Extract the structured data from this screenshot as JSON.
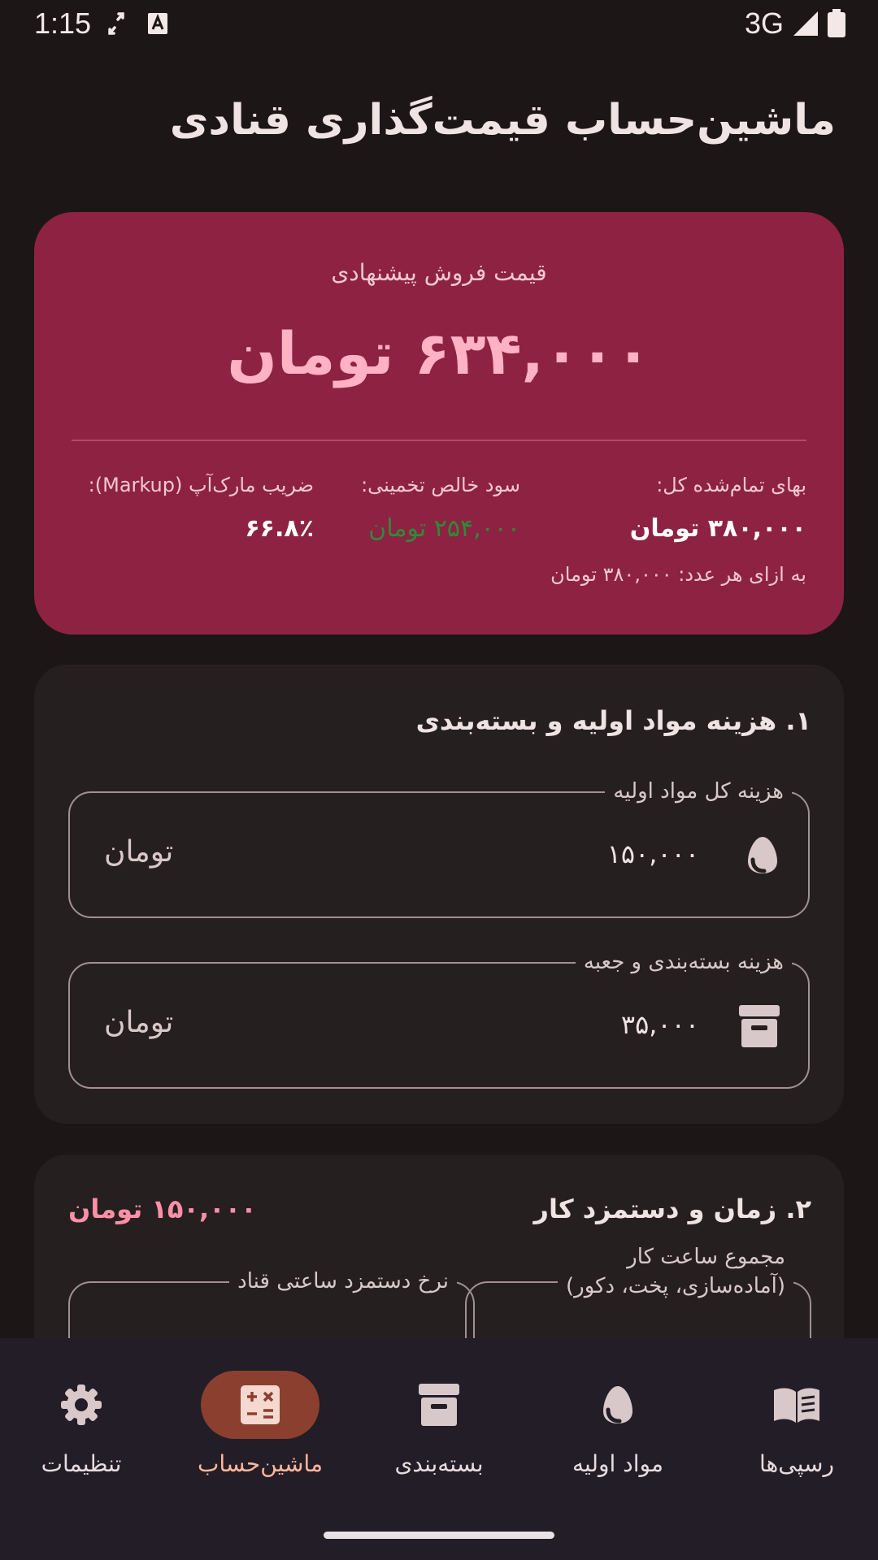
{
  "status_bar": {
    "time": "1:15",
    "network": "3G",
    "icons": [
      "sync-arrows-icon",
      "keyboard-a-icon",
      "signal-icon",
      "battery-icon"
    ]
  },
  "app": {
    "title": "ماشین‌حساب قیمت‌گذاری قنادی"
  },
  "summary": {
    "label": "قیمت فروش پیشنهادی",
    "price": "۶۳۴,۰۰۰ تومان",
    "total_cost_label": "بهای تمام‌شده کل:",
    "total_cost_value": "۳۸۰,۰۰۰ تومان",
    "profit_label": "سود خالص تخمینی:",
    "profit_value": "۲۵۴,۰۰۰ تومان",
    "markup_label": "ضریب مارک‌آپ (Markup):",
    "markup_value": "۶۶.۸٪",
    "per_unit": "به ازای هر عدد: ۳۸۰,۰۰۰ تومان"
  },
  "section1": {
    "title": "۱. هزینه مواد اولیه و بسته‌بندی",
    "ingredients": {
      "label": "هزینه کل مواد اولیه",
      "value": "۱۵۰,۰۰۰",
      "suffix": "تومان",
      "icon": "egg-icon"
    },
    "packaging": {
      "label": "هزینه بسته‌بندی و جعبه",
      "value": "۳۵,۰۰۰",
      "suffix": "تومان",
      "icon": "archive-box-icon"
    }
  },
  "section2": {
    "title": "۲. زمان و دستمزد کار",
    "total": "۱۵۰,۰۰۰ تومان",
    "hours_label_1": "مجموع ساعت کار",
    "hours_label_2": "(آماده‌سازی، پخت، دکور)",
    "rate_label": "نرخ دستمزد ساعتی قناد"
  },
  "bottom_nav": {
    "items": [
      {
        "label": "رسپی‌ها",
        "icon": "recipe-book-icon"
      },
      {
        "label": "مواد اولیه",
        "icon": "egg-icon"
      },
      {
        "label": "بسته‌بندی",
        "icon": "archive-box-icon"
      },
      {
        "label": "ماشین‌حساب",
        "icon": "calculator-icon",
        "active": true
      },
      {
        "label": "تنظیمات",
        "icon": "gear-icon"
      }
    ]
  },
  "colors": {
    "background": "#1c1617",
    "summary_card": "#8e2243",
    "price": "#ffb2c4",
    "profit": "#2e8b3a",
    "section_total": "#ff8fa8",
    "active_nav": "#8b3f2e"
  }
}
